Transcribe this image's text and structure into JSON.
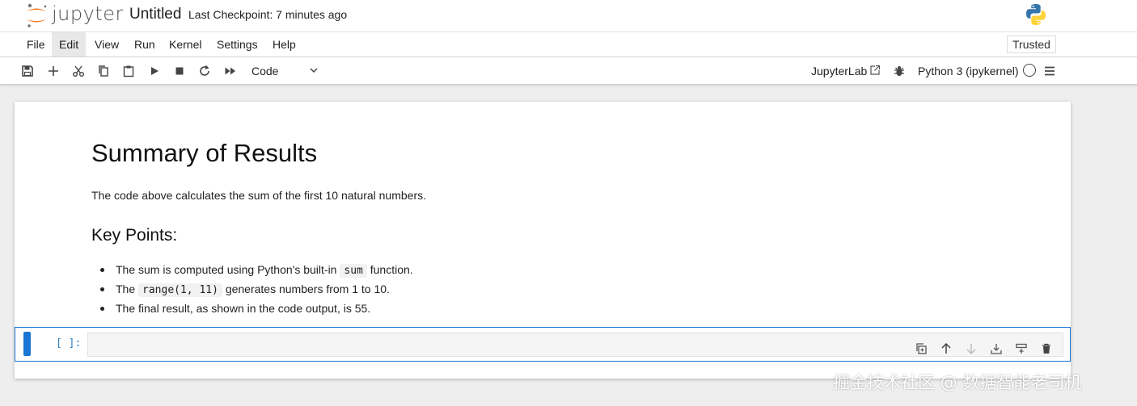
{
  "header": {
    "brand": "jupyter",
    "notebook_title": "Untitled",
    "checkpoint": "Last Checkpoint: 7 minutes ago"
  },
  "menubar": {
    "items": [
      "File",
      "Edit",
      "View",
      "Run",
      "Kernel",
      "Settings",
      "Help"
    ],
    "active": "Edit",
    "trusted": "Trusted"
  },
  "toolbar": {
    "buttons": [
      "save-icon",
      "add-icon",
      "cut-icon",
      "copy-icon",
      "paste-icon",
      "run-icon",
      "stop-icon",
      "restart-icon",
      "fast-forward-icon"
    ],
    "cell_type": "Code",
    "jupyterlab_link": "JupyterLab",
    "kernel_name": "Python 3 (ipykernel)"
  },
  "markdown": {
    "heading": "Summary of Results",
    "paragraph": "The code above calculates the sum of the first 10 natural numbers.",
    "subheading": "Key Points:",
    "bullets": [
      {
        "before": "The sum is computed using Python's built-in ",
        "code": "sum",
        "after": " function."
      },
      {
        "before": "The ",
        "code": "range(1, 11)",
        "after": " generates numbers from 1 to 10."
      },
      {
        "before": "The final result, as shown in the code output, is 55.",
        "code": "",
        "after": ""
      }
    ]
  },
  "code_cell": {
    "prompt": "[ ]:",
    "cell_toolbar": [
      "duplicate-icon",
      "move-up-icon",
      "move-down-icon",
      "insert-below-icon",
      "insert-above-icon",
      "delete-icon"
    ]
  },
  "watermark": "掘金技术社区 @ 数据智能老司机",
  "colors": {
    "accent": "#1976d2",
    "logo_orange": "#f37726",
    "python_blue": "#3776ab",
    "python_yellow": "#ffd43b"
  }
}
